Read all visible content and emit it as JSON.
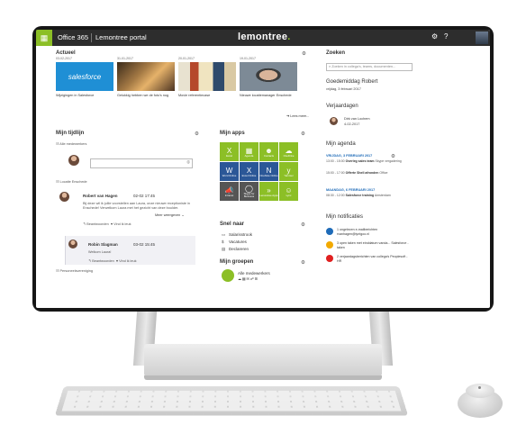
{
  "topbar": {
    "app_name": "Office 365",
    "portal": "Lemontree portal",
    "logo": "lemontree",
    "logo_dot": ".",
    "settings_icon": "gear-icon",
    "help": "?"
  },
  "actueel": {
    "title": "Actueel",
    "items": [
      {
        "date": "03-02-2017",
        "caption": "Wijzigingen in Salesforce",
        "image_text": "salesforce"
      },
      {
        "date": "31-01-2017",
        "caption": "Gelukkig hebben we de foto's nog"
      },
      {
        "date": "20-01-2017",
        "caption": "Movie referentiecase"
      },
      {
        "date": "19-01-2017",
        "caption": "Nieuwe locatiemanager Enschede"
      }
    ],
    "read_more": "Lees meer..."
  },
  "tijdlijn": {
    "title": "Mijn tijdlijn",
    "filter": "Alle medewerkers",
    "location": "Locatie Enschede",
    "post": {
      "author": "Robert van Hagen",
      "time": "02-02 17:45",
      "text": "Bij deze wil ik jullie voorstellen aan Laura, onze nieuwe receptioniste in Enschede! Verwelkom Laura met het gezicht van deze boulder.",
      "actions_like": "Beantwoorden",
      "actions_reply": "Vind ik leuk"
    },
    "more_replies": "Meer weergeven",
    "reply": {
      "author": "Robin Slagman",
      "time": "03-02 15:45",
      "text": "Welkom Laura!",
      "actions_like": "Beantwoorden",
      "actions_reply": "Vind ik leuk"
    },
    "footer": "Personeelsvereniging"
  },
  "apps": {
    "title": "Mijn apps",
    "tiles": [
      {
        "label": "Excel",
        "color": "#8cbf26",
        "icon": "X"
      },
      {
        "label": "Agenda",
        "color": "#8cbf26",
        "icon": "▦"
      },
      {
        "label": "Contacts",
        "color": "#8cbf26",
        "icon": "☻"
      },
      {
        "label": "OneDrive",
        "color": "#8cbf26",
        "icon": "☁"
      },
      {
        "label": "Word Online",
        "color": "#2b5797",
        "icon": "W"
      },
      {
        "label": "Excel Online",
        "color": "#2b5797",
        "icon": "X"
      },
      {
        "label": "OneNote Online",
        "color": "#2b5797",
        "icon": "N"
      },
      {
        "label": "Yammer",
        "color": "#8cbf26",
        "icon": "y"
      },
      {
        "label": "Intranet",
        "color": "#555555",
        "icon": "📣"
      },
      {
        "label": "Skype for Business",
        "color": "#555555",
        "icon": "◯"
      },
      {
        "label": "Lemontree Apps",
        "color": "#8cbf26",
        "icon": "»"
      },
      {
        "label": "Lync",
        "color": "#8cbf26",
        "icon": "☺"
      }
    ]
  },
  "snel": {
    "title": "Snel naar",
    "items": [
      "Salarisstrook",
      "Vacatures",
      "Declareren"
    ]
  },
  "groepen": {
    "title": "Mijn groepen",
    "group": "Alle medewerkers"
  },
  "right": {
    "zoeken_title": "Zoeken",
    "search_placeholder": "Zoeken in collega's, teams, documenten...",
    "greeting": "Goedemiddag Robert",
    "greeting_date": "vrijdag, 3 februari 2017",
    "verjaardagen_title": "Verjaardagen",
    "birthday_name": "Dirk van Lochem",
    "birthday_date": "4-02-2017",
    "agenda_title": "Mijn agenda",
    "agenda_day1": "VRIJDAG, 3 FEBRUARI 2017",
    "events_day1": [
      {
        "time": "13:00 - 15:00",
        "title": "Overleg sales team",
        "sub": "Skype vergadering"
      },
      {
        "time": "15:00 - 17:00",
        "title": "Offerte Shell afronden",
        "sub": "Office"
      }
    ],
    "agenda_day2": "MAANDAG, 6 FEBRUARI 2017",
    "events_day2": [
      {
        "time": "08:30 - 12:00",
        "title": "Salesforce training",
        "sub": "Amsterdam"
      }
    ],
    "notificaties_title": "Mijn notificaties",
    "notifications": [
      {
        "text": "1 ongelezen e-mailberichten rvanhagen@lyntgoo.nl",
        "color": "#1e6bb8"
      },
      {
        "text": "3 open taken met einddatum vanda... Salesforce - taken",
        "color": "#f2a900"
      },
      {
        "text": "2 verjaardagsberichten van collega's Peoplesoft - HR",
        "color": "#e02020"
      }
    ]
  }
}
